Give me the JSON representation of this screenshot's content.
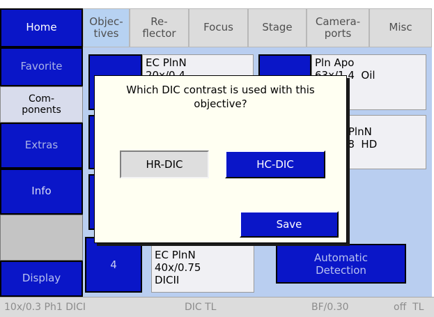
{
  "nav": {
    "home": "Home",
    "favorite": "Favorite",
    "components": "Com-\nponents",
    "extras": "Extras",
    "info": "Info",
    "display": "Display"
  },
  "tabs": [
    {
      "label": "Objec-\ntives"
    },
    {
      "label": "Re-\nflector"
    },
    {
      "label": "Focus"
    },
    {
      "label": "Stage"
    },
    {
      "label": "Camera-\nports"
    },
    {
      "label": "Misc"
    }
  ],
  "objectives": {
    "slot2_label": "EC PlnN\n20x/0.4\nDICII",
    "slot3_label": "Pln Apo\n63x/1.4  Oil\nDICIII",
    "slot5_label": "EC EpiPlnN\n50x/0.8  HD",
    "slot4_number": "4",
    "slot4_label": "EC PlnN\n40x/0.75\nDICII",
    "automatic_detection": "Automatic\nDetection"
  },
  "dialog": {
    "question": "Which DIC contrast is used with this objective?",
    "option_hr": "HR-DIC",
    "option_hc": "HC-DIC",
    "save": "Save",
    "selected": "HC-DIC"
  },
  "status": {
    "objective": "10x/0.3 Ph1 DICI",
    "contrast": "DIC TL",
    "brightfield": "BF/0.30",
    "light": "off  TL"
  },
  "colors": {
    "accent_blue": "#0a16c8",
    "content_bg": "#b9cef0",
    "dialog_bg": "#fffff2"
  }
}
